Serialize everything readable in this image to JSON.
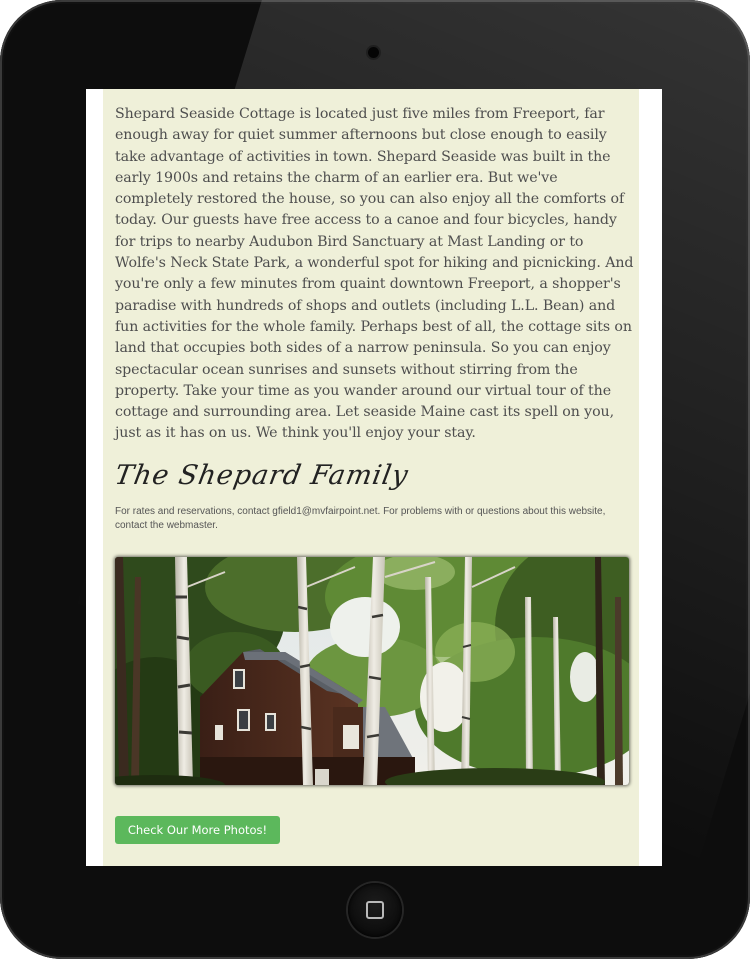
{
  "intro_text": "Shepard Seaside Cottage is located just five miles from Freeport, far enough away for quiet summer afternoons but close enough to easily take advantage of activities in town. Shepard Seaside was built in the early 1900s and retains the charm of an earlier era. But we've completely restored the house, so you can also enjoy all the comforts of today. Our guests have free access to a canoe and four bicycles, handy for trips to nearby Audubon Bird Sanctuary at Mast Landing or to Wolfe's Neck State Park, a wonderful spot for hiking and picnicking. And you're only a few minutes from quaint downtown Freeport, a shopper's paradise with hundreds of shops and outlets (including L.L. Bean) and fun activities for the whole family. Perhaps best of all, the cottage sits on land that occupies both sides of a narrow peninsula. So you can enjoy spectacular ocean sunrises and sunsets without stirring from the property. Take your time as you wander around our virtual tour of the cottage and surrounding area. Let seaside Maine cast its spell on you, just as it has on us. We think you'll enjoy your stay.",
  "signature": "The Shepard Family",
  "contact": {
    "before_email": "For rates and reservations, contact ",
    "email": "gfield1@mvfairpoint.net",
    "middle": ". For problems with or questions about this website, contact ",
    "webmaster": "the webmaster",
    "after": "."
  },
  "photos_button_label": "Check Our More Photos!",
  "icons": {
    "home_button": "home-square-icon",
    "camera": "camera-icon"
  },
  "colors": {
    "content_background": "#eff0d9",
    "button_green": "#5cb85c",
    "device_body": "#0d0d0d"
  }
}
